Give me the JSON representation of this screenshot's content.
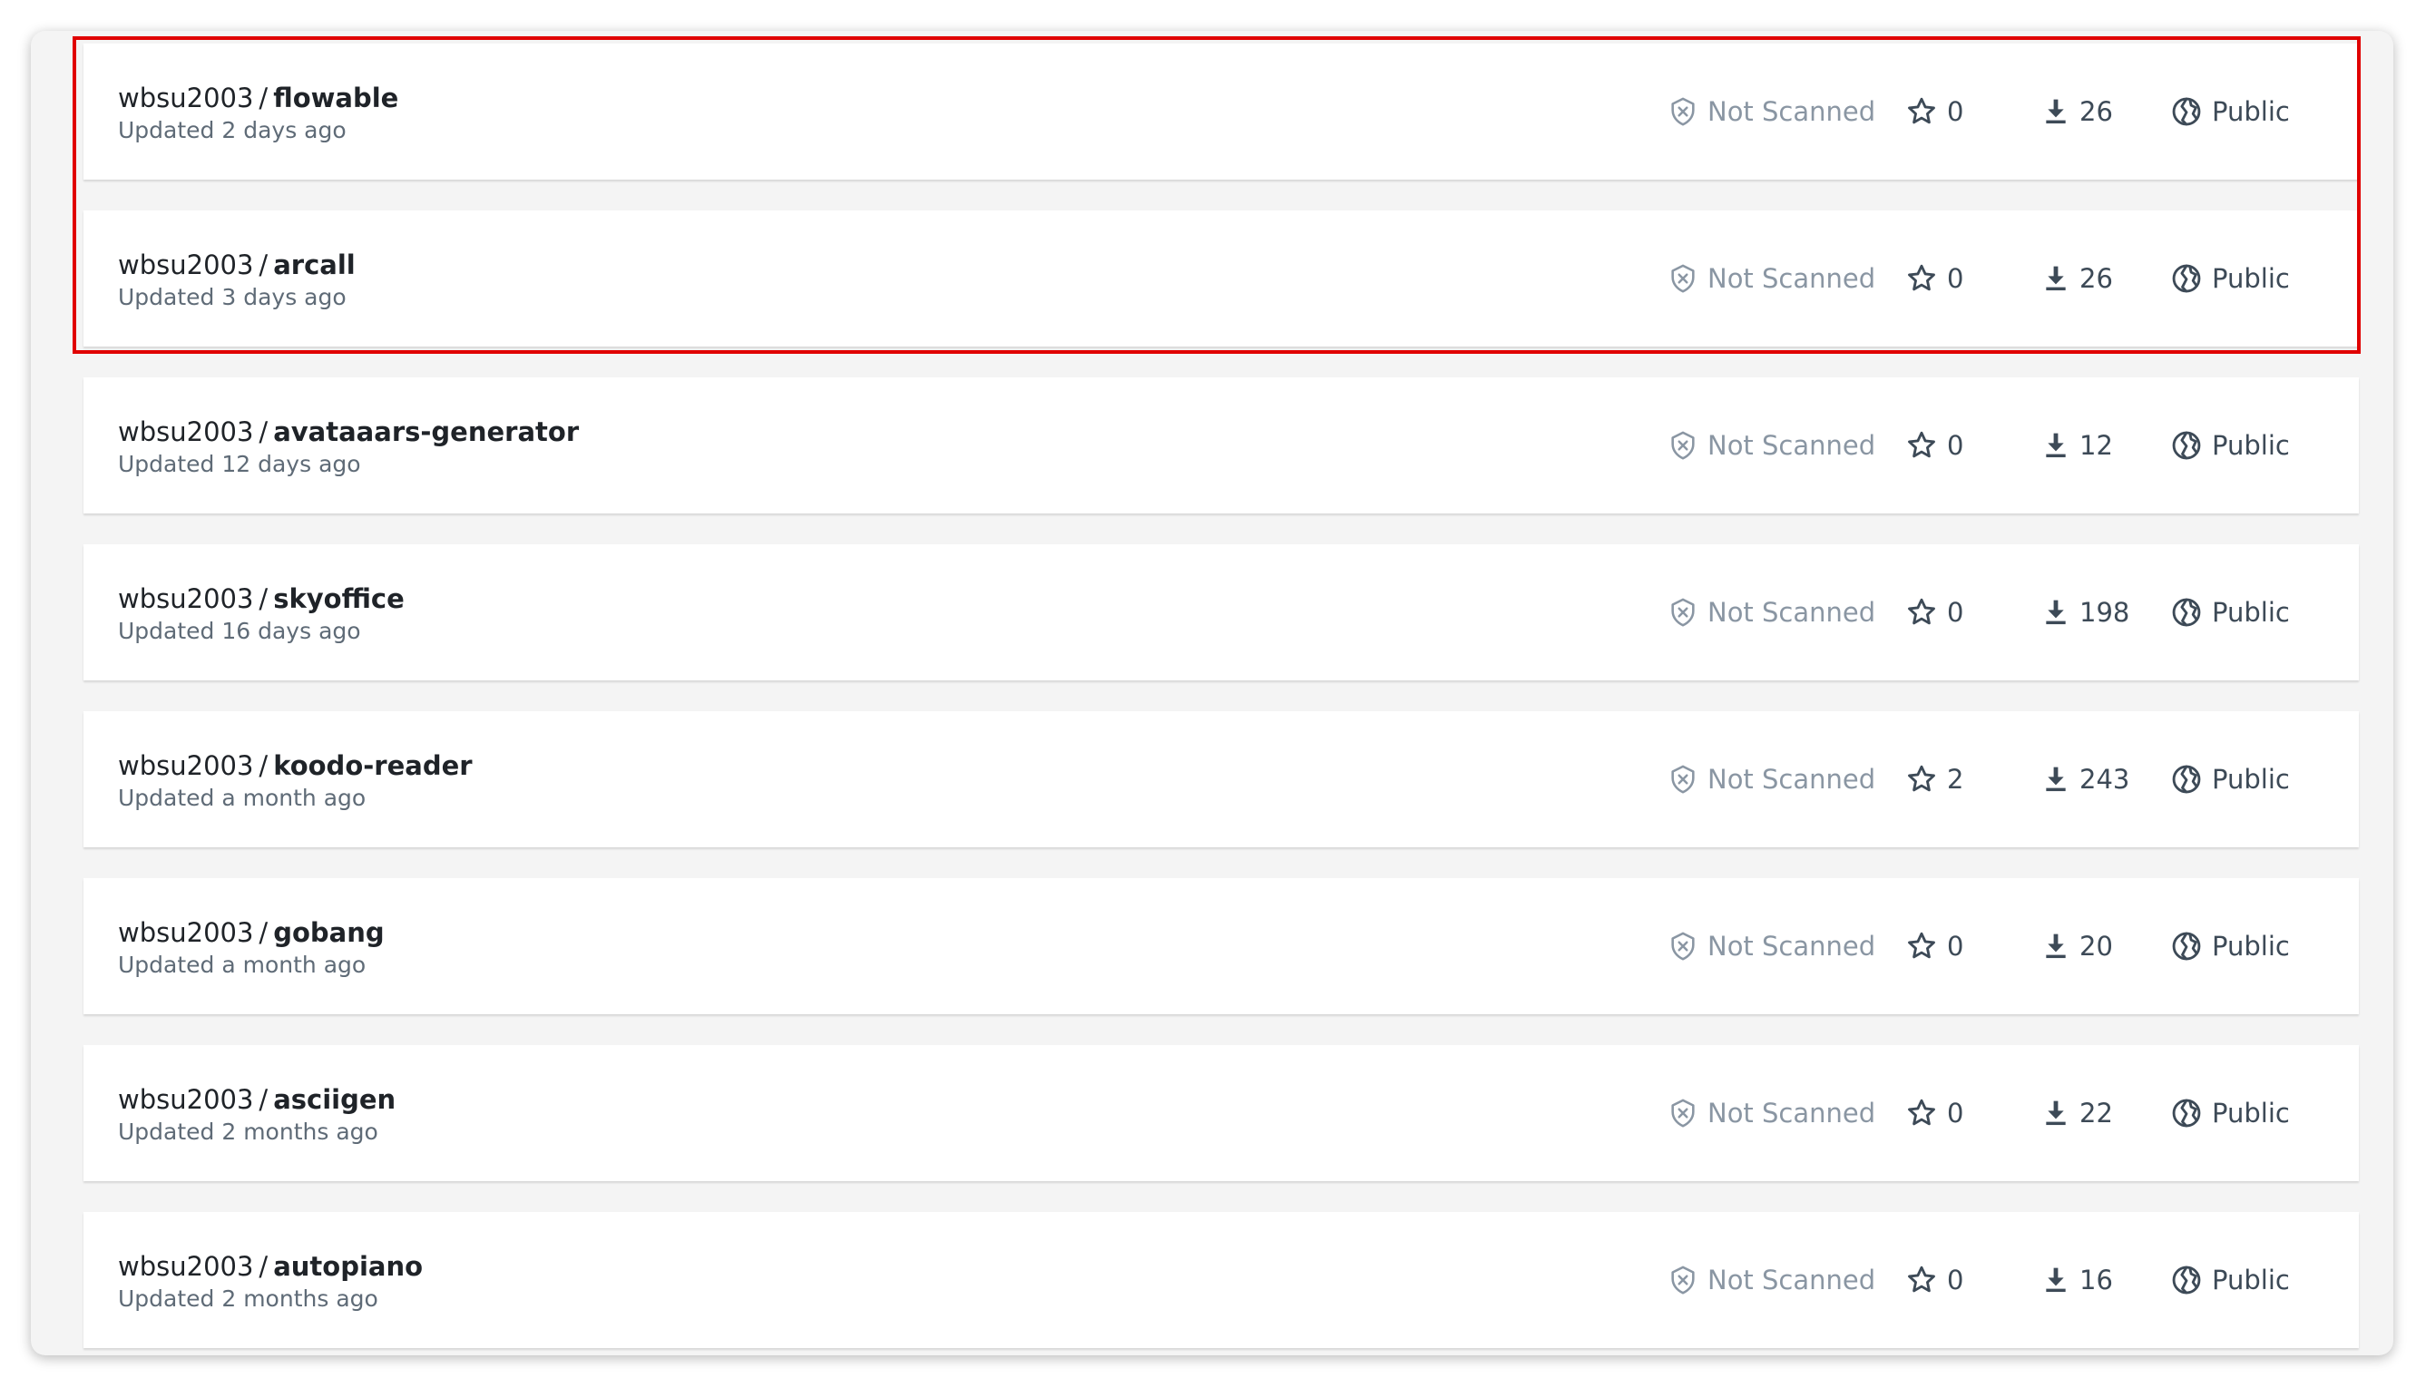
{
  "repositories": [
    {
      "owner": "wbsu2003",
      "separator": "/",
      "name": "flowable",
      "updated": "Updated 2 days ago",
      "scan_status": "Not Scanned",
      "stars": "0",
      "pulls": "26",
      "visibility": "Public"
    },
    {
      "owner": "wbsu2003",
      "separator": "/",
      "name": "arcall",
      "updated": "Updated 3 days ago",
      "scan_status": "Not Scanned",
      "stars": "0",
      "pulls": "26",
      "visibility": "Public"
    },
    {
      "owner": "wbsu2003",
      "separator": "/",
      "name": "avataaars-generator",
      "updated": "Updated 12 days ago",
      "scan_status": "Not Scanned",
      "stars": "0",
      "pulls": "12",
      "visibility": "Public"
    },
    {
      "owner": "wbsu2003",
      "separator": "/",
      "name": "skyoffice",
      "updated": "Updated 16 days ago",
      "scan_status": "Not Scanned",
      "stars": "0",
      "pulls": "198",
      "visibility": "Public"
    },
    {
      "owner": "wbsu2003",
      "separator": "/",
      "name": "koodo-reader",
      "updated": "Updated a month ago",
      "scan_status": "Not Scanned",
      "stars": "2",
      "pulls": "243",
      "visibility": "Public"
    },
    {
      "owner": "wbsu2003",
      "separator": "/",
      "name": "gobang",
      "updated": "Updated a month ago",
      "scan_status": "Not Scanned",
      "stars": "0",
      "pulls": "20",
      "visibility": "Public"
    },
    {
      "owner": "wbsu2003",
      "separator": "/",
      "name": "asciigen",
      "updated": "Updated 2 months ago",
      "scan_status": "Not Scanned",
      "stars": "0",
      "pulls": "22",
      "visibility": "Public"
    },
    {
      "owner": "wbsu2003",
      "separator": "/",
      "name": "autopiano",
      "updated": "Updated 2 months ago",
      "scan_status": "Not Scanned",
      "stars": "0",
      "pulls": "16",
      "visibility": "Public"
    }
  ],
  "icons": {
    "scan": "shield-x-icon",
    "stars": "star-icon",
    "pulls": "download-icon",
    "visibility": "globe-icon"
  },
  "colors": {
    "highlight": "#e00000",
    "muted": "#8a96a3",
    "text": "#1f2328"
  }
}
